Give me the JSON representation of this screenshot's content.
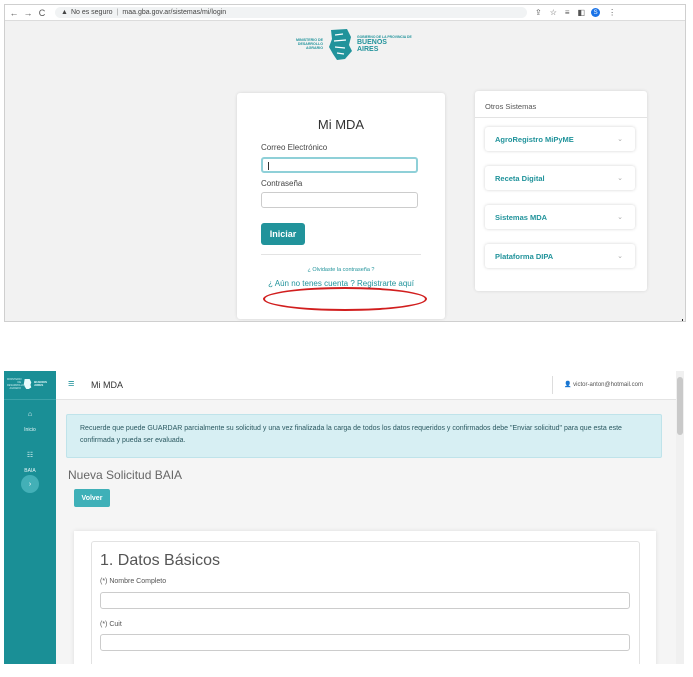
{
  "browser": {
    "back_icon": "←",
    "forward_icon": "→",
    "reload_icon": "C",
    "security_label": "No es seguro",
    "url": "maa.gba.gov.ar/sistemas/mi/login",
    "profile_initial": "S"
  },
  "login_page": {
    "logo": {
      "ministry": "MINISTERIO DE DESARROLLO AGRARIO",
      "gobierno": "GOBIERNO DE LA PROVINCIA DE",
      "buenos": "BUENOS",
      "aires": "AIRES"
    },
    "title": "Mi MDA",
    "email_label": "Correo Electrónico",
    "password_label": "Contraseña",
    "submit_label": "Iniciar",
    "forgot_link": "¿ Olvidaste la contraseña ?",
    "register_link": "¿ Aún no tenes cuenta ? Registrarte aquí",
    "highlight_color": "#d11e1e"
  },
  "otros_sistemas": {
    "title": "Otros Sistemas",
    "items": [
      {
        "label": "AgroRegistro MiPyME"
      },
      {
        "label": "Receta Digital"
      },
      {
        "label": "Sistemas MDA"
      },
      {
        "label": "Plataforma DIPA"
      }
    ]
  },
  "app": {
    "sidebar": {
      "logo_left": "MINISTERIO DE DESARROLLO AGRARIO",
      "logo_right": "BUENOS AIRES",
      "items": [
        {
          "label": "Inicio",
          "icon": "home-icon"
        },
        {
          "label": "BAIA",
          "icon": "grid-icon"
        }
      ]
    },
    "title": "Mi MDA",
    "user_email": "victor-anton@hotmail.com",
    "alert_text": "Recuerde que puede GUARDAR parcialmente su solicitud y una vez finalizada la carga de todos los datos requeridos y confirmados debe \"Enviar solicitud\" para que esta este confirmada y pueda ser evaluada.",
    "page_title": "Nueva Solicitud BAIA",
    "back_button": "Volver",
    "section_title": "1. Datos Básicos",
    "fields": [
      {
        "label": "(*) Nombre Completo",
        "value": ""
      },
      {
        "label": "(*) Cuit",
        "value": ""
      }
    ],
    "accent_color": "#1a8f96"
  }
}
